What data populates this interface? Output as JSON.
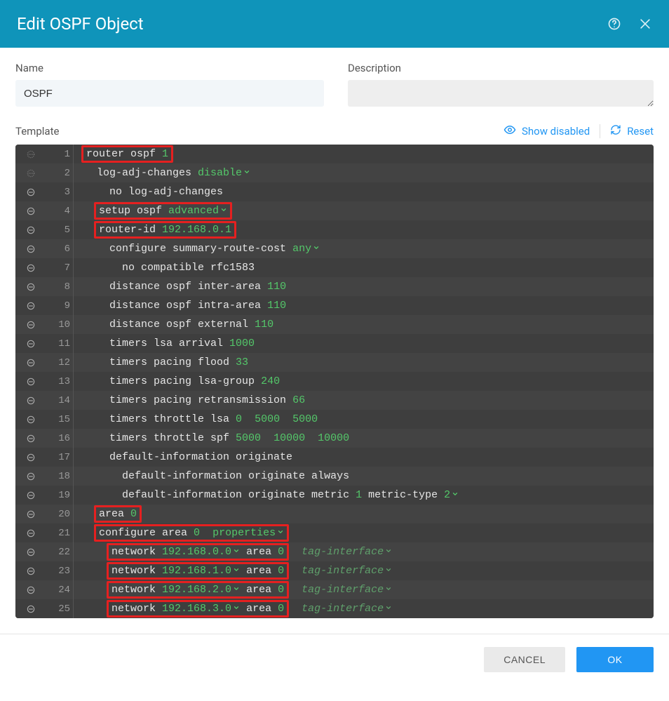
{
  "header": {
    "title": "Edit OSPF Object"
  },
  "form": {
    "name_label": "Name",
    "name_value": "OSPF",
    "description_label": "Description",
    "description_value": ""
  },
  "template_bar": {
    "label": "Template",
    "show_disabled": "Show disabled",
    "reset": "Reset"
  },
  "editor": {
    "lines": [
      {
        "n": 1,
        "toggle": "dash",
        "indent": 0,
        "highlight": true,
        "segments": [
          {
            "t": "router ospf ",
            "c": "kw"
          },
          {
            "t": "1",
            "c": "val"
          }
        ]
      },
      {
        "n": 2,
        "toggle": "dash",
        "indent": 1,
        "highlight": false,
        "segments": [
          {
            "t": "log-adj-changes ",
            "c": "kw"
          },
          {
            "t": "disable",
            "c": "val",
            "chev": true
          }
        ]
      },
      {
        "n": 3,
        "toggle": "circle",
        "indent": 2,
        "highlight": false,
        "segments": [
          {
            "t": "no log-adj-changes",
            "c": "kw"
          }
        ]
      },
      {
        "n": 4,
        "toggle": "circle",
        "indent": 1,
        "highlight": true,
        "segments": [
          {
            "t": "setup ospf ",
            "c": "kw"
          },
          {
            "t": "advanced",
            "c": "val",
            "chev": true
          }
        ]
      },
      {
        "n": 5,
        "toggle": "circle",
        "indent": 1,
        "highlight": true,
        "segments": [
          {
            "t": "router-id ",
            "c": "kw"
          },
          {
            "t": "192.168.0.1",
            "c": "val"
          }
        ]
      },
      {
        "n": 6,
        "toggle": "circle",
        "indent": 2,
        "highlight": false,
        "segments": [
          {
            "t": "configure summary-route-cost ",
            "c": "kw"
          },
          {
            "t": "any",
            "c": "val",
            "chev": true
          }
        ]
      },
      {
        "n": 7,
        "toggle": "circle",
        "indent": 3,
        "highlight": false,
        "segments": [
          {
            "t": "no compatible rfc1583",
            "c": "kw"
          }
        ]
      },
      {
        "n": 8,
        "toggle": "circle",
        "indent": 2,
        "highlight": false,
        "segments": [
          {
            "t": "distance ospf inter-area ",
            "c": "kw"
          },
          {
            "t": "110",
            "c": "val"
          }
        ]
      },
      {
        "n": 9,
        "toggle": "circle",
        "indent": 2,
        "highlight": false,
        "segments": [
          {
            "t": "distance ospf intra-area ",
            "c": "kw"
          },
          {
            "t": "110",
            "c": "val"
          }
        ]
      },
      {
        "n": 10,
        "toggle": "circle",
        "indent": 2,
        "highlight": false,
        "segments": [
          {
            "t": "distance ospf external ",
            "c": "kw"
          },
          {
            "t": "110",
            "c": "val"
          }
        ]
      },
      {
        "n": 11,
        "toggle": "circle",
        "indent": 2,
        "highlight": false,
        "segments": [
          {
            "t": "timers lsa arrival ",
            "c": "kw"
          },
          {
            "t": "1000",
            "c": "val"
          }
        ]
      },
      {
        "n": 12,
        "toggle": "circle",
        "indent": 2,
        "highlight": false,
        "segments": [
          {
            "t": "timers pacing flood ",
            "c": "kw"
          },
          {
            "t": "33",
            "c": "val"
          }
        ]
      },
      {
        "n": 13,
        "toggle": "circle",
        "indent": 2,
        "highlight": false,
        "segments": [
          {
            "t": "timers pacing lsa-group ",
            "c": "kw"
          },
          {
            "t": "240",
            "c": "val"
          }
        ]
      },
      {
        "n": 14,
        "toggle": "circle",
        "indent": 2,
        "highlight": false,
        "segments": [
          {
            "t": "timers pacing retransmission ",
            "c": "kw"
          },
          {
            "t": "66",
            "c": "val"
          }
        ]
      },
      {
        "n": 15,
        "toggle": "circle",
        "indent": 2,
        "highlight": false,
        "segments": [
          {
            "t": "timers throttle lsa ",
            "c": "kw"
          },
          {
            "t": "0",
            "c": "val"
          },
          {
            "t": "  ",
            "c": "kw"
          },
          {
            "t": "5000",
            "c": "val"
          },
          {
            "t": "  ",
            "c": "kw"
          },
          {
            "t": "5000",
            "c": "val"
          }
        ]
      },
      {
        "n": 16,
        "toggle": "circle",
        "indent": 2,
        "highlight": false,
        "segments": [
          {
            "t": "timers throttle spf ",
            "c": "kw"
          },
          {
            "t": "5000",
            "c": "val"
          },
          {
            "t": "  ",
            "c": "kw"
          },
          {
            "t": "10000",
            "c": "val"
          },
          {
            "t": "  ",
            "c": "kw"
          },
          {
            "t": "10000",
            "c": "val"
          }
        ]
      },
      {
        "n": 17,
        "toggle": "circle",
        "indent": 2,
        "highlight": false,
        "segments": [
          {
            "t": "default-information originate",
            "c": "kw"
          }
        ]
      },
      {
        "n": 18,
        "toggle": "circle",
        "indent": 3,
        "highlight": false,
        "segments": [
          {
            "t": "default-information originate always",
            "c": "kw"
          }
        ]
      },
      {
        "n": 19,
        "toggle": "circle",
        "indent": 3,
        "highlight": false,
        "segments": [
          {
            "t": "default-information originate metric ",
            "c": "kw"
          },
          {
            "t": "1",
            "c": "val"
          },
          {
            "t": " metric-type ",
            "c": "kw"
          },
          {
            "t": "2",
            "c": "val",
            "chev": true
          }
        ]
      },
      {
        "n": 20,
        "toggle": "circle",
        "indent": 1,
        "highlight": true,
        "segments": [
          {
            "t": "area ",
            "c": "kw"
          },
          {
            "t": "0",
            "c": "val"
          }
        ]
      },
      {
        "n": 21,
        "toggle": "circle",
        "indent": 1,
        "highlight": true,
        "segments": [
          {
            "t": "configure area ",
            "c": "kw"
          },
          {
            "t": "0",
            "c": "val"
          },
          {
            "t": "  ",
            "c": "kw"
          },
          {
            "t": "properties",
            "c": "val",
            "chev": true
          }
        ]
      },
      {
        "n": 22,
        "toggle": "circle",
        "indent": 2,
        "highlight": true,
        "segments": [
          {
            "t": "network ",
            "c": "kw"
          },
          {
            "t": "192.168.0.0",
            "c": "val",
            "chev": true
          },
          {
            "t": " area ",
            "c": "kw"
          },
          {
            "t": "0",
            "c": "val"
          }
        ],
        "trailer": "tag-interface"
      },
      {
        "n": 23,
        "toggle": "circle",
        "indent": 2,
        "highlight": true,
        "segments": [
          {
            "t": "network ",
            "c": "kw"
          },
          {
            "t": "192.168.1.0",
            "c": "val",
            "chev": true
          },
          {
            "t": " area ",
            "c": "kw"
          },
          {
            "t": "0",
            "c": "val"
          }
        ],
        "trailer": "tag-interface"
      },
      {
        "n": 24,
        "toggle": "circle",
        "indent": 2,
        "highlight": true,
        "segments": [
          {
            "t": "network ",
            "c": "kw"
          },
          {
            "t": "192.168.2.0",
            "c": "val",
            "chev": true
          },
          {
            "t": " area ",
            "c": "kw"
          },
          {
            "t": "0",
            "c": "val"
          }
        ],
        "trailer": "tag-interface"
      },
      {
        "n": 25,
        "toggle": "circle",
        "indent": 2,
        "highlight": true,
        "segments": [
          {
            "t": "network ",
            "c": "kw"
          },
          {
            "t": "192.168.3.0",
            "c": "val",
            "chev": true
          },
          {
            "t": " area ",
            "c": "kw"
          },
          {
            "t": "0",
            "c": "val"
          }
        ],
        "trailer": "tag-interface"
      }
    ]
  },
  "footer": {
    "cancel": "CANCEL",
    "ok": "OK"
  },
  "icons": {
    "chevron": "⌄"
  }
}
